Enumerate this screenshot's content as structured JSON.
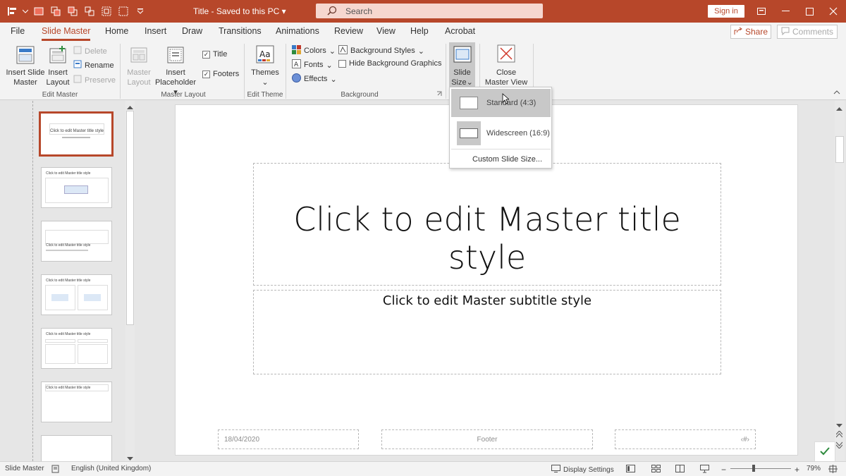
{
  "window": {
    "title": "Title - Saved to this PC",
    "search_label": "Search",
    "signin_label": "Sign in"
  },
  "tabs": [
    {
      "label": "File"
    },
    {
      "label": "Slide Master"
    },
    {
      "label": "Home"
    },
    {
      "label": "Insert"
    },
    {
      "label": "Draw"
    },
    {
      "label": "Transitions"
    },
    {
      "label": "Animations"
    },
    {
      "label": "Review"
    },
    {
      "label": "View"
    },
    {
      "label": "Help"
    },
    {
      "label": "Acrobat"
    }
  ],
  "active_tab": "Slide Master",
  "share_label": "Share",
  "comments_label": "Comments",
  "ribbon": {
    "edit_master": {
      "group_label": "Edit Master",
      "insert_slide_master_1": "Insert Slide",
      "insert_slide_master_2": "Master",
      "insert_layout_1": "Insert",
      "insert_layout_2": "Layout",
      "delete": "Delete",
      "rename": "Rename",
      "preserve": "Preserve"
    },
    "master_layout": {
      "group_label": "Master Layout",
      "master_layout_1": "Master",
      "master_layout_2": "Layout",
      "insert_placeholder_1": "Insert",
      "insert_placeholder_2": "Placeholder",
      "title": "Title",
      "footers": "Footers"
    },
    "edit_theme": {
      "group_label": "Edit Theme",
      "themes": "Themes"
    },
    "background": {
      "group_label": "Background",
      "colors": "Colors",
      "fonts": "Fonts",
      "effects": "Effects",
      "background_styles": "Background Styles",
      "hide_background_graphics": "Hide Background Graphics"
    },
    "size": {
      "slide_size_1": "Slide",
      "slide_size_2": "Size"
    },
    "close": {
      "close_1": "Close",
      "close_2": "Master View"
    }
  },
  "dropdown": {
    "standard": "Standard (4:3)",
    "widescreen": "Widescreen (16:9)",
    "custom": "Custom Slide Size..."
  },
  "thumbnails": {
    "t1": "Click to edit Master title style",
    "t2": "Click to edit Master title style",
    "t3": "Click to edit Master title style",
    "t4": "Click to edit Master title style",
    "t5": "Click to edit Master title style",
    "t6": "Click to edit Master title style"
  },
  "slide": {
    "title": "Click to edit Master title style",
    "subtitle": "Click to edit Master subtitle style",
    "date": "18/04/2020",
    "footer": "Footer",
    "number": "‹#›"
  },
  "status": {
    "view": "Slide Master",
    "language": "English (United Kingdom)",
    "display_settings": "Display Settings",
    "zoom": "79%"
  },
  "colors": {
    "accent": "#b7472a",
    "ribbon_bg": "#f3f3f3",
    "canvas_bg": "#e6e6e6"
  }
}
